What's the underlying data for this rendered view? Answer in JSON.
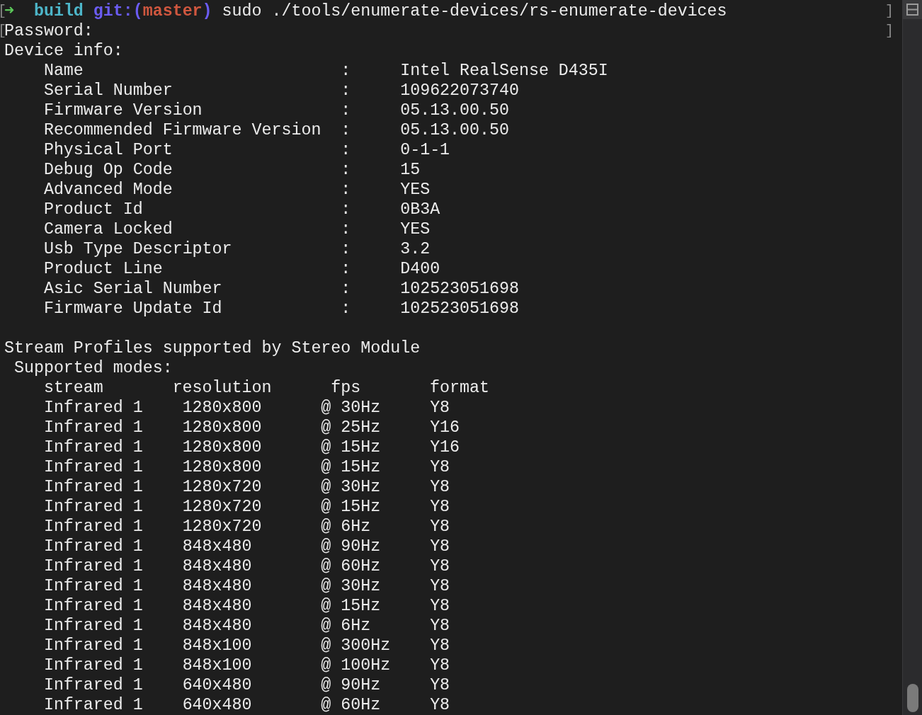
{
  "prompt": {
    "open_mark": "[",
    "arrow": "➜",
    "directory": "build",
    "git_label": "git:(",
    "branch": "master",
    "git_close": ")",
    "command": "sudo ./tools/enumerate-devices/rs-enumerate-devices",
    "close_mark": "]"
  },
  "password_line": {
    "open_mark": "[",
    "text": "Password:",
    "close_mark": "]"
  },
  "device_info": {
    "title": "Device info:",
    "fields": [
      {
        "label": "Name",
        "separator": ":",
        "value": "Intel RealSense D435I"
      },
      {
        "label": "Serial Number",
        "separator": ":",
        "value": "109622073740"
      },
      {
        "label": "Firmware Version",
        "separator": ":",
        "value": "05.13.00.50"
      },
      {
        "label": "Recommended Firmware Version",
        "separator": ":",
        "value": "05.13.00.50"
      },
      {
        "label": "Physical Port",
        "separator": ":",
        "value": "0-1-1"
      },
      {
        "label": "Debug Op Code",
        "separator": ":",
        "value": "15"
      },
      {
        "label": "Advanced Mode",
        "separator": ":",
        "value": "YES"
      },
      {
        "label": "Product Id",
        "separator": ":",
        "value": "0B3A"
      },
      {
        "label": "Camera Locked",
        "separator": ":",
        "value": "YES"
      },
      {
        "label": "Usb Type Descriptor",
        "separator": ":",
        "value": "3.2"
      },
      {
        "label": "Product Line",
        "separator": ":",
        "value": "D400"
      },
      {
        "label": "Asic Serial Number",
        "separator": ":",
        "value": "102523051698"
      },
      {
        "label": "Firmware Update Id",
        "separator": ":",
        "value": "102523051698"
      }
    ]
  },
  "stream_profiles": {
    "title": "Stream Profiles supported by Stereo Module",
    "subtitle": "Supported modes:",
    "columns": [
      "stream",
      "resolution",
      "fps",
      "format"
    ],
    "rows": [
      {
        "stream": "Infrared 1",
        "resolution": "1280x800",
        "fps": "@ 30Hz",
        "format": "Y8"
      },
      {
        "stream": "Infrared 1",
        "resolution": "1280x800",
        "fps": "@ 25Hz",
        "format": "Y16"
      },
      {
        "stream": "Infrared 1",
        "resolution": "1280x800",
        "fps": "@ 15Hz",
        "format": "Y16"
      },
      {
        "stream": "Infrared 1",
        "resolution": "1280x800",
        "fps": "@ 15Hz",
        "format": "Y8"
      },
      {
        "stream": "Infrared 1",
        "resolution": "1280x720",
        "fps": "@ 30Hz",
        "format": "Y8"
      },
      {
        "stream": "Infrared 1",
        "resolution": "1280x720",
        "fps": "@ 15Hz",
        "format": "Y8"
      },
      {
        "stream": "Infrared 1",
        "resolution": "1280x720",
        "fps": "@ 6Hz",
        "format": "Y8"
      },
      {
        "stream": "Infrared 1",
        "resolution": "848x480",
        "fps": "@ 90Hz",
        "format": "Y8"
      },
      {
        "stream": "Infrared 1",
        "resolution": "848x480",
        "fps": "@ 60Hz",
        "format": "Y8"
      },
      {
        "stream": "Infrared 1",
        "resolution": "848x480",
        "fps": "@ 30Hz",
        "format": "Y8"
      },
      {
        "stream": "Infrared 1",
        "resolution": "848x480",
        "fps": "@ 15Hz",
        "format": "Y8"
      },
      {
        "stream": "Infrared 1",
        "resolution": "848x480",
        "fps": "@ 6Hz",
        "format": "Y8"
      },
      {
        "stream": "Infrared 1",
        "resolution": "848x100",
        "fps": "@ 300Hz",
        "format": "Y8"
      },
      {
        "stream": "Infrared 1",
        "resolution": "848x100",
        "fps": "@ 100Hz",
        "format": "Y8"
      },
      {
        "stream": "Infrared 1",
        "resolution": "640x480",
        "fps": "@ 90Hz",
        "format": "Y8"
      },
      {
        "stream": "Infrared 1",
        "resolution": "640x480",
        "fps": "@ 60Hz",
        "format": "Y8"
      }
    ]
  }
}
